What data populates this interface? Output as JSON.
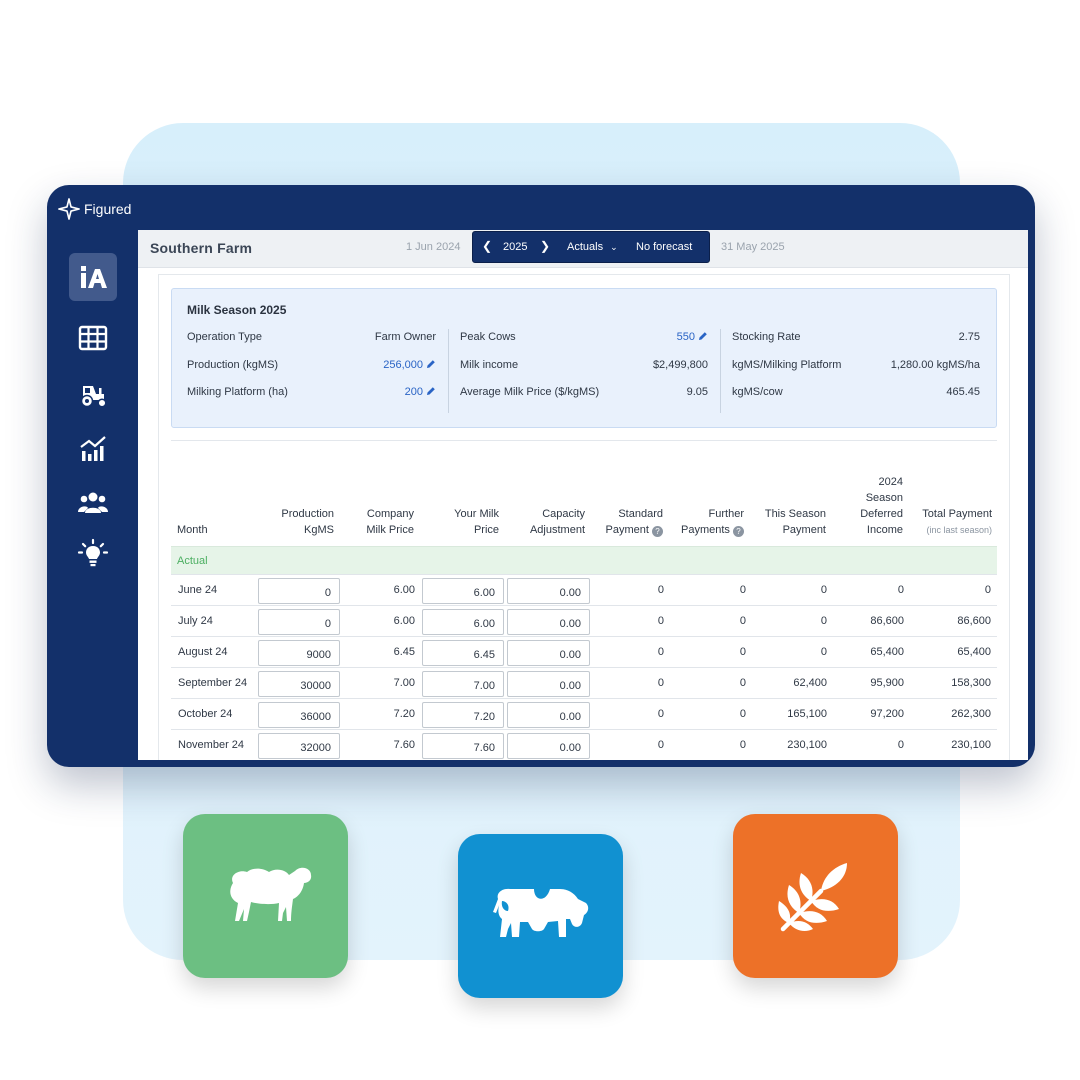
{
  "brand": {
    "name": "Figured"
  },
  "sidebar": {
    "items": [
      {
        "icon": "farm-ia-icon",
        "active": true
      },
      {
        "icon": "grid-icon",
        "active": false
      },
      {
        "icon": "tractor-icon",
        "active": false
      },
      {
        "icon": "chart-icon",
        "active": false
      },
      {
        "icon": "people-icon",
        "active": false
      },
      {
        "icon": "lightbulb-icon",
        "active": false
      }
    ]
  },
  "header": {
    "farm_name": "Southern  Farm",
    "date_start": "1 Jun 2024",
    "date_end": "31 May 2025",
    "year": "2025",
    "mode": "Actuals",
    "forecast": "No forecast"
  },
  "summary": {
    "title": "Milk Season 2025",
    "col1": [
      {
        "label": "Operation Type",
        "value": "Farm Owner",
        "editable": false
      },
      {
        "label": "Production (kgMS)",
        "value": "256,000",
        "editable": true
      },
      {
        "label": "Milking Platform (ha)",
        "value": "200",
        "editable": true
      }
    ],
    "col2": [
      {
        "label": "Peak Cows",
        "value": "550",
        "editable": true
      },
      {
        "label": "Milk income",
        "value": "$2,499,800",
        "editable": false
      },
      {
        "label": "Average Milk Price ($/kgMS)",
        "value": "9.05",
        "editable": false
      }
    ],
    "col3": [
      {
        "label": "Stocking Rate",
        "value": "2.75"
      },
      {
        "label": "kgMS/Milking Platform",
        "value": "1,280.00 kgMS/ha"
      },
      {
        "label": "kgMS/cow",
        "value": "465.45"
      }
    ]
  },
  "table": {
    "headers": {
      "month": "Month",
      "production": [
        "Production",
        "KgMS"
      ],
      "company_price": [
        "Company",
        "Milk Price"
      ],
      "your_price": [
        "Your Milk",
        "Price"
      ],
      "capacity": [
        "Capacity",
        "Adjustment"
      ],
      "standard": [
        "Standard",
        "Payment"
      ],
      "further": [
        "Further",
        "Payments"
      ],
      "this_season": [
        "This Season",
        "Payment"
      ],
      "deferred": [
        "2024",
        "Season",
        "Deferred",
        "Income"
      ],
      "total": [
        "Total Payment",
        "(inc last season)"
      ]
    },
    "section": "Actual",
    "rows": [
      {
        "month": "June 24",
        "production": "0",
        "company_price": "6.00",
        "your_price": "6.00",
        "capacity": "0.00",
        "standard": "0",
        "further": "0",
        "this_season": "0",
        "deferred": "0",
        "total": "0"
      },
      {
        "month": "July 24",
        "production": "0",
        "company_price": "6.00",
        "your_price": "6.00",
        "capacity": "0.00",
        "standard": "0",
        "further": "0",
        "this_season": "0",
        "deferred": "86,600",
        "total": "86,600"
      },
      {
        "month": "August 24",
        "production": "9000",
        "company_price": "6.45",
        "your_price": "6.45",
        "capacity": "0.00",
        "standard": "0",
        "further": "0",
        "this_season": "0",
        "deferred": "65,400",
        "total": "65,400"
      },
      {
        "month": "September 24",
        "production": "30000",
        "company_price": "7.00",
        "your_price": "7.00",
        "capacity": "0.00",
        "standard": "0",
        "further": "0",
        "this_season": "62,400",
        "deferred": "95,900",
        "total": "158,300"
      },
      {
        "month": "October 24",
        "production": "36000",
        "company_price": "7.20",
        "your_price": "7.20",
        "capacity": "0.00",
        "standard": "0",
        "further": "0",
        "this_season": "165,100",
        "deferred": "97,200",
        "total": "262,300"
      },
      {
        "month": "November 24",
        "production": "32000",
        "company_price": "7.60",
        "your_price": "7.60",
        "capacity": "0.00",
        "standard": "0",
        "further": "0",
        "this_season": "230,100",
        "deferred": "0",
        "total": "230,100"
      }
    ]
  },
  "tiles": [
    {
      "icon": "sheep-icon",
      "color": "#6cbf82"
    },
    {
      "icon": "cow-icon",
      "color": "#1191d1"
    },
    {
      "icon": "wheat-icon",
      "color": "#ed7128"
    }
  ],
  "colors": {
    "navy": "#13306a",
    "link": "#2a64c5",
    "actual_green": "#4caf62"
  }
}
